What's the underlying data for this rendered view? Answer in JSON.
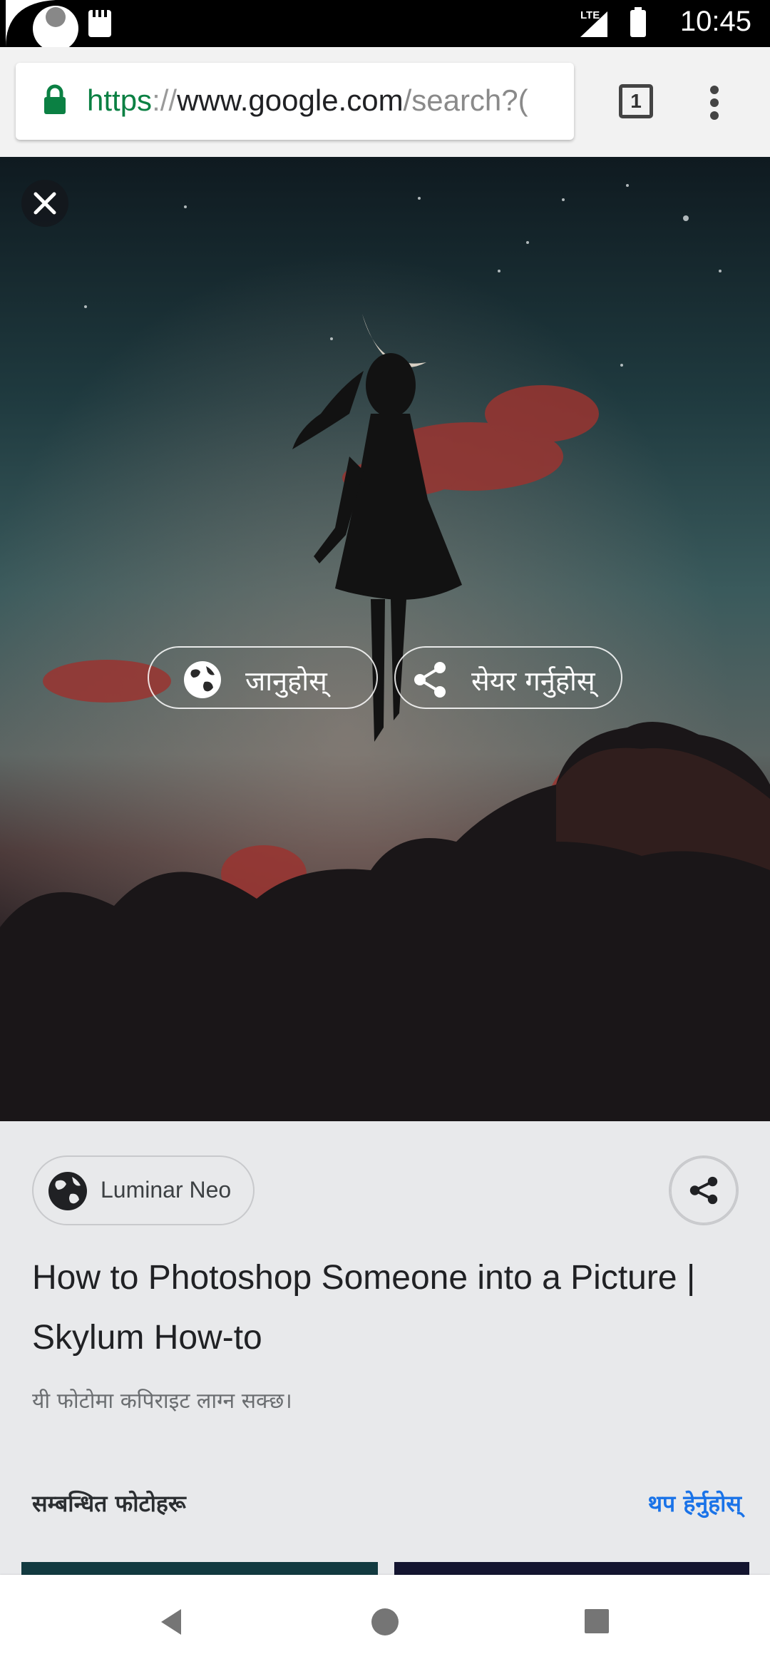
{
  "status_bar": {
    "time": "10:45",
    "network_label": "LTE",
    "icons": [
      "sd-card-icon",
      "signal-icon",
      "battery-icon"
    ]
  },
  "browser": {
    "url_scheme": "https",
    "url_separator": "://",
    "url_host": "www.google.com",
    "url_path": "/search?(",
    "tab_count": "1",
    "scheme_color": "#0b8043"
  },
  "viewer": {
    "visit_label": "जानुहोस्",
    "share_label": "सेयर गर्नुहोस्"
  },
  "details": {
    "source_name": "Luminar Neo",
    "title": "How to Photoshop Someone into a Picture | Skylum How-to",
    "copyright_note": "यी फोटोमा कपिराइट लाग्न सक्छ।",
    "related_heading": "सम्बन्धित फोटोहरू",
    "see_more_label": "थप हेर्नुहोस्",
    "link_color": "#1a73e8"
  },
  "nav_bar": {
    "buttons": [
      "back-icon",
      "home-icon",
      "recents-icon"
    ]
  }
}
